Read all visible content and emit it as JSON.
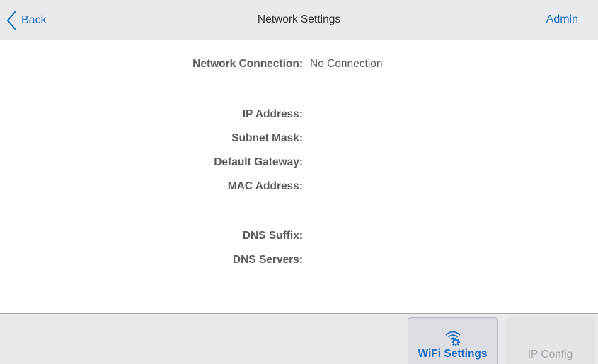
{
  "header": {
    "back_label": "Back",
    "title": "Network Settings",
    "user_label": "Admin"
  },
  "fields": {
    "network_connection": {
      "label": "Network Connection:",
      "value": "No Connection"
    },
    "ip_address": {
      "label": "IP Address:",
      "value": ""
    },
    "subnet_mask": {
      "label": "Subnet Mask:",
      "value": ""
    },
    "default_gateway": {
      "label": "Default Gateway:",
      "value": ""
    },
    "mac_address": {
      "label": "MAC Address:",
      "value": ""
    },
    "dns_suffix": {
      "label": "DNS Suffix:",
      "value": ""
    },
    "dns_servers": {
      "label": "DNS Servers:",
      "value": ""
    }
  },
  "footer": {
    "wifi_settings_label": "WiFi Settings",
    "ip_config_label": "IP Config"
  },
  "icons": {
    "back": "chevron-left-icon",
    "wifi_settings": "wifi-gear-icon"
  },
  "colors": {
    "accent": "#1c6fc4",
    "header_bg": "#e9eaee",
    "label_text": "#5a5a5a",
    "disabled_text": "#a3a3a8"
  }
}
